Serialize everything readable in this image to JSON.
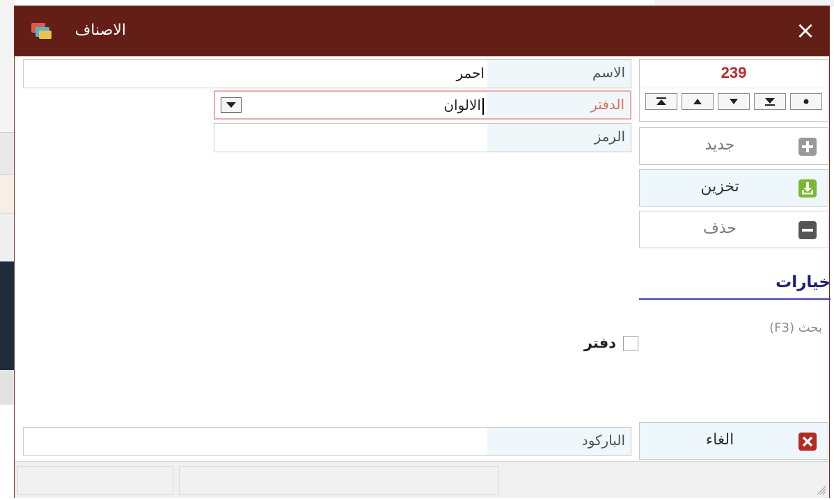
{
  "window": {
    "title": "الاصناف",
    "close_glyph": "×",
    "title_bar_color": "#631e15",
    "app_icon": "stacked-books-icon"
  },
  "navigator": {
    "record_number": "239",
    "buttons": [
      "first-record-icon",
      "previous-record-icon",
      "next-record-icon",
      "last-record-icon",
      "dot-icon"
    ]
  },
  "actions": {
    "new_label": "جديد",
    "save_label": "تخزين",
    "delete_label": "حذف",
    "cancel_label": "الغاء"
  },
  "fields": {
    "name_label": "الاسم",
    "name_value": "احمر",
    "group_label": "الدفتر",
    "group_value": "الالوان",
    "code_label": "الرمز",
    "code_value": "",
    "barcode_label": "الباركود",
    "barcode_value": ""
  },
  "options": {
    "title": "خيارات",
    "search_hint": "بحث (F3)",
    "checkbox_label": "دفتر",
    "checkbox_checked": false
  },
  "colors": {
    "accent_red": "#c0272d",
    "options_blue": "#3b3bcc",
    "save_green": "#79b92f",
    "cancel_red": "#b8281e"
  }
}
